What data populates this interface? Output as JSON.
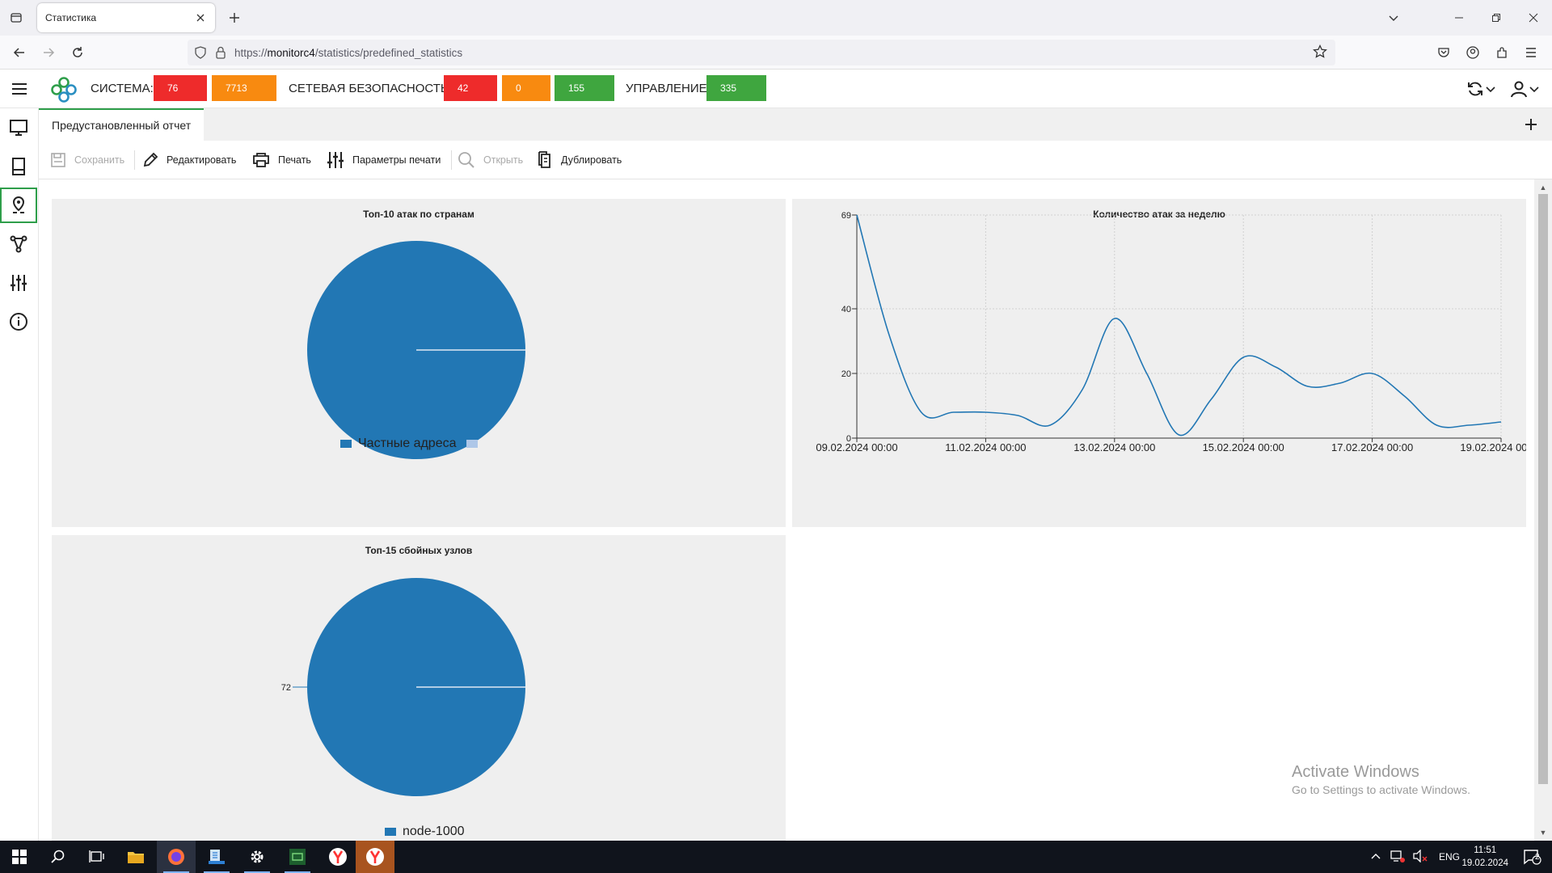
{
  "browser": {
    "tab_title": "Статистика",
    "url_prefix": "https://",
    "url_host": "monitorc4",
    "url_path": "/statistics/predefined_statistics"
  },
  "header": {
    "sistema_label": "СИСТЕМА:",
    "sistema_values": [
      "76",
      "7713"
    ],
    "netsec_label": "СЕТЕВАЯ БЕЗОПАСНОСТЬ:",
    "netsec_values": [
      "42",
      "0",
      "155"
    ],
    "control_label": "УПРАВЛЕНИЕ:",
    "control_value": "335",
    "colors": {
      "red": "#ee2b2b",
      "orange": "#f88a10",
      "green": "#3fa63f"
    }
  },
  "doc_tab": "Предустановленный отчет",
  "toolbar": {
    "save": "Сохранить",
    "edit": "Редактировать",
    "print": "Печать",
    "print_params": "Параметры печати",
    "open": "Открыть",
    "duplicate": "Дублировать"
  },
  "chart_data": [
    {
      "type": "pie",
      "title": "Топ-10 атак по странам",
      "slices": [
        {
          "label": "Частные адреса",
          "value": 1,
          "color": "#2277b4"
        },
        {
          "label": "",
          "value": 0,
          "color": "#aec7e8"
        }
      ]
    },
    {
      "type": "line",
      "title": "Количество атак за неделю",
      "xlabels": [
        "09.02.2024 00:00",
        "11.02.2024 00:00",
        "13.02.2024 00:00",
        "15.02.2024 00:00",
        "17.02.2024 00:00",
        "19.02.2024 00:00"
      ],
      "yticks": [
        0,
        20,
        40,
        69
      ],
      "ylim": [
        0,
        69
      ],
      "x": [
        "09.02.2024 00:00",
        "09.02.2024 12:00",
        "10.02.2024 00:00",
        "10.02.2024 12:00",
        "11.02.2024 00:00",
        "11.02.2024 12:00",
        "12.02.2024 00:00",
        "12.02.2024 12:00",
        "13.02.2024 00:00",
        "13.02.2024 12:00",
        "14.02.2024 00:00",
        "14.02.2024 12:00",
        "15.02.2024 00:00",
        "15.02.2024 12:00",
        "16.02.2024 00:00",
        "16.02.2024 12:00",
        "17.02.2024 00:00",
        "17.02.2024 12:00",
        "18.02.2024 00:00",
        "18.02.2024 12:00",
        "19.02.2024 00:00"
      ],
      "values": [
        69,
        32,
        8,
        8,
        8,
        7,
        4,
        15,
        37,
        20,
        1,
        12,
        25,
        22,
        16,
        17,
        20,
        13,
        4,
        4,
        5
      ],
      "color": "#2277b4",
      "grid": true
    },
    {
      "type": "pie",
      "title": "Топ-15 сбойных узлов",
      "slices": [
        {
          "label": "node-1000",
          "value": 72,
          "color": "#2277b4"
        }
      ],
      "value_label": "72"
    }
  ],
  "watermark": {
    "line1": "Activate Windows",
    "line2": "Go to Settings to activate Windows."
  },
  "taskbar": {
    "lang": "ENG",
    "time": "11:51",
    "date": "19.02.2024",
    "notifications": "2"
  }
}
